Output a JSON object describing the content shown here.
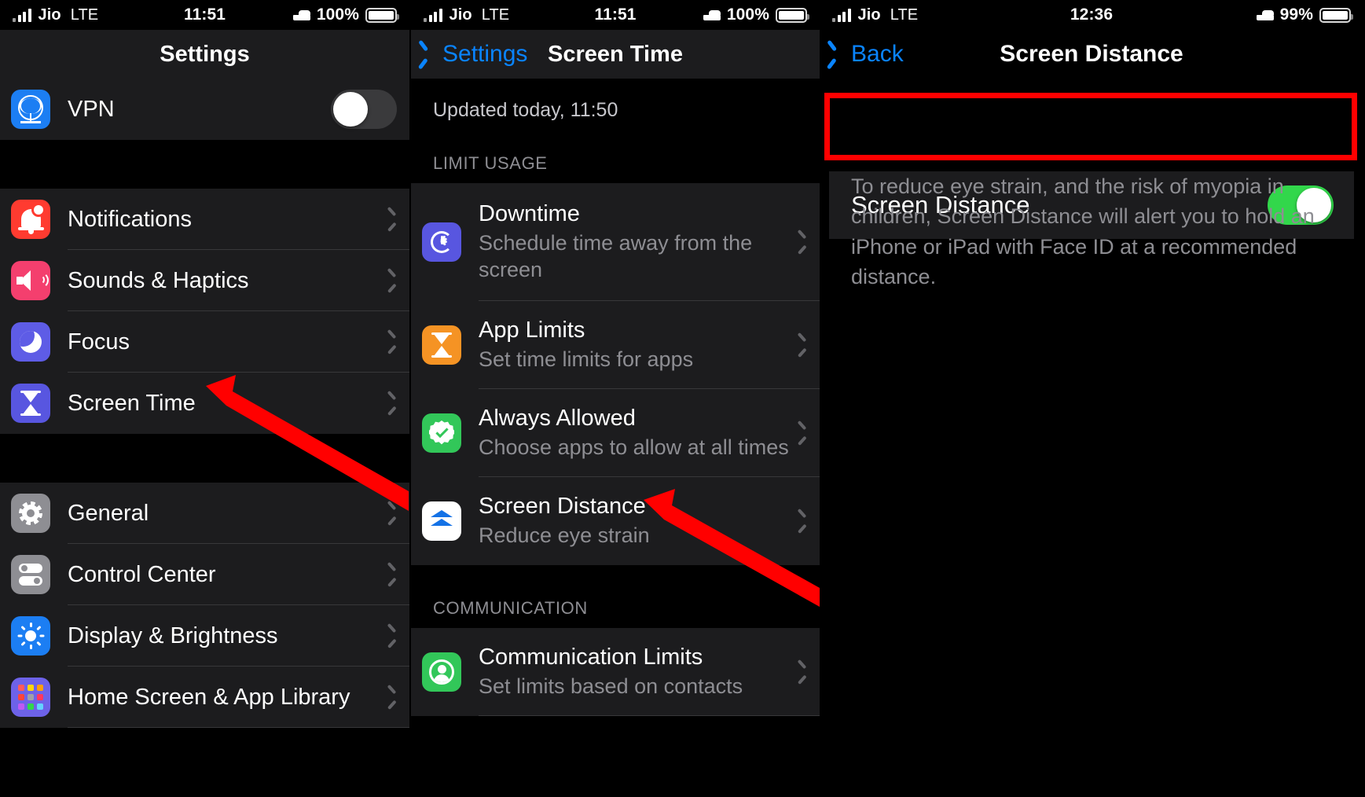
{
  "panels": [
    {
      "id": "settings",
      "status": {
        "carrier": "Jio",
        "network": "LTE",
        "time": "11:51",
        "battery": "100%"
      },
      "nav": {
        "title": "Settings"
      },
      "groups": [
        {
          "rows": [
            {
              "label": "VPN",
              "icon": "globe-icon",
              "accessory": "toggle",
              "toggle": "off"
            }
          ]
        },
        {
          "rows": [
            {
              "label": "Notifications",
              "icon": "bell-icon",
              "accessory": "chevron"
            },
            {
              "label": "Sounds & Haptics",
              "icon": "speaker-icon",
              "accessory": "chevron"
            },
            {
              "label": "Focus",
              "icon": "moon-icon",
              "accessory": "chevron"
            },
            {
              "label": "Screen Time",
              "icon": "hourglass-icon",
              "accessory": "chevron"
            }
          ]
        },
        {
          "rows": [
            {
              "label": "General",
              "icon": "gear-icon",
              "accessory": "chevron"
            },
            {
              "label": "Control Center",
              "icon": "control-center-icon",
              "accessory": "chevron"
            },
            {
              "label": "Display & Brightness",
              "icon": "sun-icon",
              "accessory": "chevron"
            },
            {
              "label": "Home Screen & App Library",
              "icon": "app-grid-icon",
              "accessory": "chevron"
            }
          ]
        }
      ]
    },
    {
      "id": "screen-time",
      "status": {
        "carrier": "Jio",
        "network": "LTE",
        "time": "11:51",
        "battery": "100%"
      },
      "nav": {
        "back": "Settings",
        "title": "Screen Time"
      },
      "updated": "Updated today, 11:50",
      "sections": [
        {
          "header": "LIMIT USAGE",
          "rows": [
            {
              "title": "Downtime",
              "subtitle": "Schedule time away from the screen",
              "icon": "downtime-icon"
            },
            {
              "title": "App Limits",
              "subtitle": "Set time limits for apps",
              "icon": "hourglass-orange-icon"
            },
            {
              "title": "Always Allowed",
              "subtitle": "Choose apps to allow at all times",
              "icon": "check-badge-icon"
            },
            {
              "title": "Screen Distance",
              "subtitle": "Reduce eye strain",
              "icon": "screen-distance-icon"
            }
          ]
        },
        {
          "header": "COMMUNICATION",
          "rows": [
            {
              "title": "Communication Limits",
              "subtitle": "Set limits based on contacts",
              "icon": "person-circle-icon"
            }
          ]
        }
      ]
    },
    {
      "id": "screen-distance",
      "status": {
        "carrier": "Jio",
        "network": "LTE",
        "time": "12:36",
        "battery": "99%"
      },
      "nav": {
        "back": "Back",
        "title": "Screen Distance"
      },
      "toggle_row": {
        "label": "Screen Distance",
        "state": "on"
      },
      "description": "To reduce eye strain, and the risk of myopia in children, Screen Distance will alert you to hold an iPhone or iPad with Face ID at a recommended distance."
    }
  ],
  "annotations": {
    "highlight_color": "#ff0000",
    "arrow_color": "#ff0000",
    "arrow_1_target": "Screen Time",
    "arrow_2_target": "Screen Distance"
  },
  "colors": {
    "toggle_on": "#32d74b",
    "toggle_off": "#3a3a3c",
    "tint_blue": "#0a84ff",
    "row_bg": "#1c1c1e",
    "page_bg": "#000000",
    "secondary_text": "#8e8e93"
  }
}
